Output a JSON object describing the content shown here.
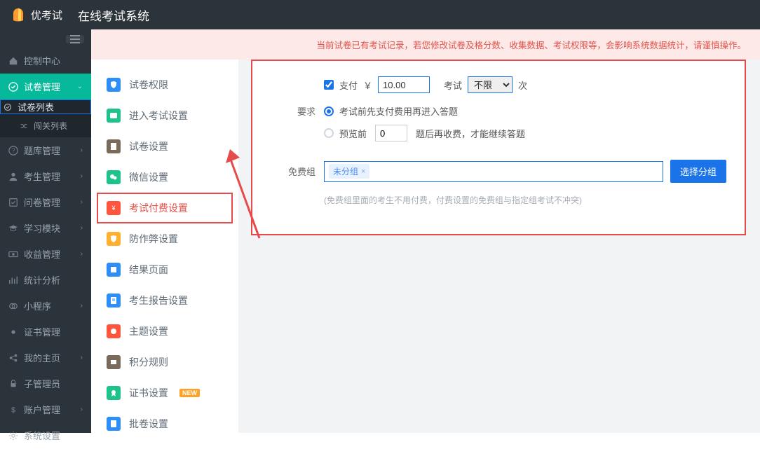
{
  "header": {
    "brand": "优考试",
    "system_title": "在线考试系统"
  },
  "sidebar": {
    "items": [
      {
        "label": "控制中心"
      },
      {
        "label": "试卷管理",
        "active": true
      },
      {
        "label": "题库管理"
      },
      {
        "label": "考生管理"
      },
      {
        "label": "问卷管理"
      },
      {
        "label": "学习模块"
      },
      {
        "label": "收益管理"
      },
      {
        "label": "统计分析"
      },
      {
        "label": "小程序"
      },
      {
        "label": "证书管理"
      },
      {
        "label": "我的主页"
      },
      {
        "label": "子管理员"
      },
      {
        "label": "账户管理"
      },
      {
        "label": "系统设置"
      }
    ],
    "sub_items": [
      {
        "label": "试卷列表"
      },
      {
        "label": "闯关列表"
      }
    ]
  },
  "notice": "当前试卷已有考试记录，若您修改试卷及格分数、收集数据、考试权限等，会影响系统数据统计，请谨慎操作。",
  "settings_nav": [
    {
      "label": "试卷权限",
      "color": "#2e8ef7"
    },
    {
      "label": "进入考试设置",
      "color": "#1ec28b"
    },
    {
      "label": "试卷设置",
      "color": "#7a6a5a"
    },
    {
      "label": "微信设置",
      "color": "#1ec28b"
    },
    {
      "label": "考试付费设置",
      "color": "#ff553d",
      "selected": true
    },
    {
      "label": "防作弊设置",
      "color": "#ffb02e"
    },
    {
      "label": "结果页面",
      "color": "#2e8ef7"
    },
    {
      "label": "考生报告设置",
      "color": "#2e8ef7"
    },
    {
      "label": "主题设置",
      "color": "#ff553d"
    },
    {
      "label": "积分规则",
      "color": "#7a6a5a"
    },
    {
      "label": "证书设置",
      "color": "#1ec28b",
      "badge": "NEW"
    },
    {
      "label": "批卷设置",
      "color": "#2e8ef7"
    }
  ],
  "form": {
    "pay_label": "支付",
    "currency": "￥",
    "amount": "10.00",
    "exam_label": "考试",
    "limit_selected": "不限",
    "times_suffix": "次",
    "require_label": "要求",
    "option_pay_first": "考试前先支付费用再进入答题",
    "option_preview_prefix": "预览前",
    "preview_count": "0",
    "option_preview_suffix": "题后再收费，才能继续答题",
    "free_group_label": "免费组",
    "free_group_tag": "未分组",
    "select_group_btn": "选择分组",
    "hint": "(免费组里面的考生不用付费，付费设置的免费组与指定组考试不冲突)"
  }
}
